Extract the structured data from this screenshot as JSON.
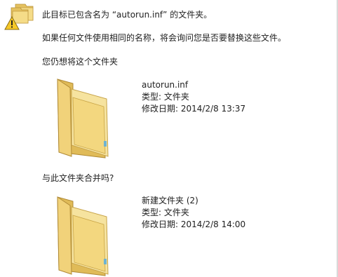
{
  "dialog": {
    "title_line": "此目标已包含名为 “autorun.inf” 的文件夹。",
    "description": "如果任何文件使用相同的名称，将会询问您是否要替换这些文件。",
    "question_keep": "您仍想将这个文件夹",
    "question_merge": "与此文件夹合并吗?"
  },
  "source_folder": {
    "name": "autorun.inf",
    "type_label": "类型: ",
    "type_value": "文件夹",
    "modified_label": "修改日期: ",
    "modified_value": "2014/2/8 13:37"
  },
  "target_folder": {
    "name": "新建文件夹 (2)",
    "type_label": "类型: ",
    "type_value": "文件夹",
    "modified_label": "修改日期: ",
    "modified_value": "2014/2/8 14:00"
  },
  "icons": {
    "warning": "folders-warning-icon",
    "folder": "folder-icon"
  },
  "colors": {
    "folder_front": "#f3d77f",
    "folder_back": "#e3bf5e",
    "warning_yellow": "#f6c828"
  }
}
